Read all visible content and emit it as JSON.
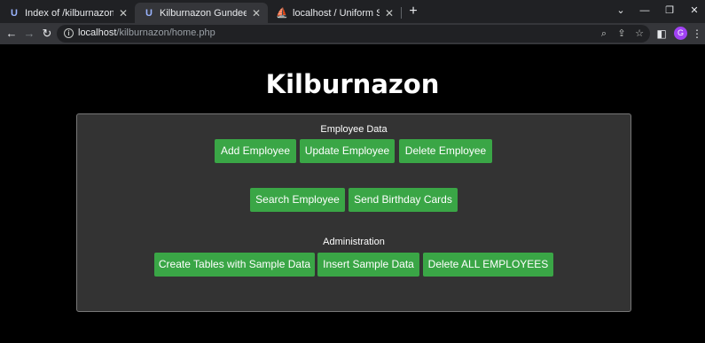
{
  "browser": {
    "tabs": [
      {
        "title": "Index of /kilburnazon",
        "icon": "uniform-server-icon",
        "active": false
      },
      {
        "title": "Kilburnazon Gundeep Oberoi",
        "icon": "uniform-server-icon",
        "active": true
      },
      {
        "title": "localhost / Uniform Server / kilb",
        "icon": "phpmyadmin-icon",
        "active": false
      }
    ],
    "url": {
      "host": "localhost",
      "path": "/kilburnazon/home.php"
    },
    "profile_initial": "G",
    "profile_color": "#a142f4"
  },
  "page": {
    "title": "Kilburnazon",
    "employee_section_label": "Employee Data",
    "admin_section_label": "Administration",
    "buttons": {
      "add_employee": "Add Employee",
      "update_employee": "Update Employee",
      "delete_employee": "Delete Employee",
      "search_employee": "Search Employee",
      "send_birthday_cards": "Send Birthday Cards",
      "create_tables": "Create Tables with Sample Data",
      "insert_sample": "Insert Sample Data",
      "delete_all": "Delete ALL EMPLOYEES"
    },
    "colors": {
      "button": "#3aa646",
      "panel": "#333333",
      "background": "#000000"
    }
  }
}
